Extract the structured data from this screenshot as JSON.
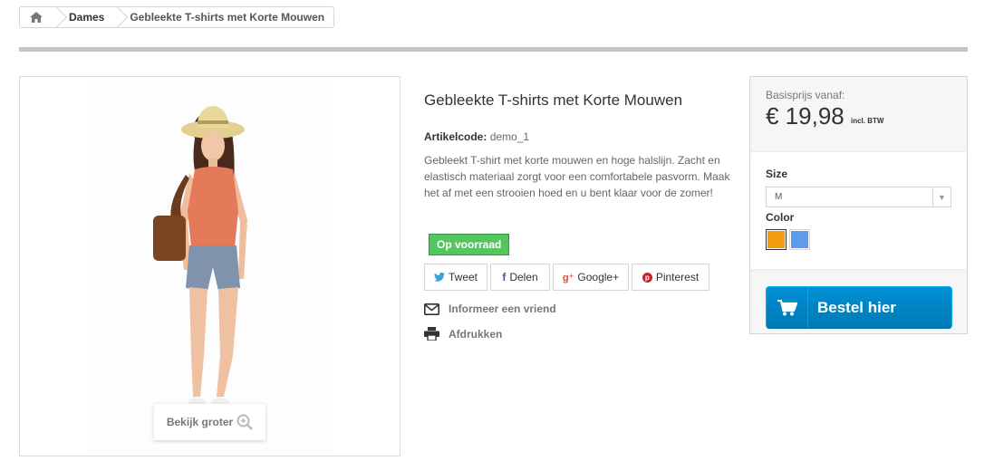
{
  "breadcrumb": {
    "home_icon": "home-icon",
    "items": [
      "Dames",
      "Gebleekte T-shirts met Korte Mouwen"
    ]
  },
  "image_panel": {
    "zoom_label": "Bekijk groter",
    "zoom_icon": "zoom-in-icon"
  },
  "product": {
    "title": "Gebleekte T-shirts met Korte Mouwen",
    "ref_label": "Artikelcode:",
    "ref_value": "demo_1",
    "description": "Gebleekt T-shirt met korte mouwen en hoge halslijn. Zacht en elastisch materiaal zorgt voor een comfortabele pasvorm. Maak het af met een strooien hoed en u bent klaar voor de zomer!",
    "stock": "Op voorraad"
  },
  "social": {
    "tweet": "Tweet",
    "delen": "Delen",
    "gplus": "Google+",
    "pinterest": "Pinterest"
  },
  "actions": {
    "friend": "Informeer een vriend",
    "print": "Afdrukken"
  },
  "buybox": {
    "price_label": "Basisprijs vanaf:",
    "price": "€ 19,98",
    "tax": "incl. BTW",
    "size_label": "Size",
    "size_value": "M",
    "color_label": "Color",
    "colors": [
      "#f39c11",
      "#5d9cec"
    ],
    "cart_label": "Bestel hier"
  },
  "colors": {
    "accent_blue": "#0090d5",
    "stock_green": "#55c65e"
  }
}
